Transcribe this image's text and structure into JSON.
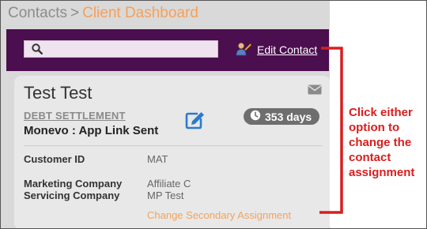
{
  "breadcrumb": {
    "root": "Contacts",
    "separator": ">",
    "current": "Client Dashboard"
  },
  "header": {
    "search_value": "",
    "edit_contact_label": "Edit Contact"
  },
  "card": {
    "name": "Test Test",
    "product": "DEBT SETTLEMENT",
    "status": "Monevo : App Link Sent",
    "days_badge": "353 days",
    "fields": {
      "customer_id_label": "Customer ID",
      "customer_id_value": "MAT",
      "marketing_label": "Marketing Company",
      "marketing_value": "Affiliate C",
      "servicing_label": "Servicing Company",
      "servicing_value": "MP Test"
    },
    "assignment_link": "Change Secondary Assignment"
  },
  "annotation": {
    "lines": [
      "Click either",
      "option to",
      "change the",
      "contact",
      "assignment"
    ],
    "color": "#d81e1e"
  },
  "colors": {
    "header_bg": "#4b0e4f",
    "accent_orange": "#f5a05a",
    "badge_bg": "#6e6e6e",
    "edit_icon": "#2a7bd1"
  },
  "icons": {
    "search": "search-icon",
    "edit_contact": "person-icon",
    "mail": "mail-icon",
    "edit": "edit-icon",
    "clock": "clock-icon"
  }
}
